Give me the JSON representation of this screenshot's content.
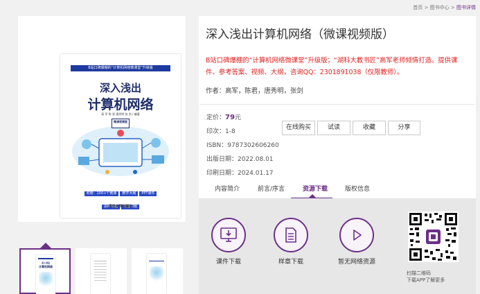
{
  "breadcrumb": {
    "home": "首页",
    "sep": " > ",
    "center": "图书中心",
    "current": "图书详情"
  },
  "cover": {
    "banner": "B站口碑爆棚的“计算机网络微课堂”升级版",
    "title_line1": "深入浅出",
    "title_line2": "计算机网络",
    "authors": "高 军  陈 君  唐秀明  张 剑 / 编著",
    "tag": "微课视频版",
    "pills": [
      "附赠：100+个微课",
      "教学大纲",
      "PPT课件",
      "思维导图",
      "配套习题"
    ],
    "publisher": "清华大学出版社"
  },
  "book": {
    "title": "深入浅出计算机网络（微课视频版）",
    "promo": "B站口碑爆棚的“计算机网络微课堂”升级版；“湖科大教书匠”高军老师倾情打造。提供课件、参考答案、视频、大纲，咨询QQ：2301891038（仅限教师）。",
    "author": "作者：高军，陈君，唐秀明，张剑",
    "price_label": "定价：",
    "price": "79",
    "price_unit": "元",
    "impression": "印次：1-8",
    "isbn": "ISBN：9787302606260",
    "pub_date": "出版日期：2022.08.01",
    "print_date": "印刷日期：2024.01.17"
  },
  "actions": {
    "buy": "在线购买",
    "read": "试读",
    "favorite": "收藏",
    "share": "分享"
  },
  "tabs": [
    "内容简介",
    "前言/序言",
    "资源下载",
    "版权信息"
  ],
  "resources": [
    {
      "label": "课件下载",
      "icon": "monitor-download-icon"
    },
    {
      "label": "样章下载",
      "icon": "document-icon"
    },
    {
      "label": "暂无网络资源",
      "icon": "play-icon"
    }
  ],
  "qr": {
    "caption1": "扫描二维码",
    "caption2": "下载APP了解更多"
  },
  "colors": {
    "accent": "#6b2f87",
    "promo": "#e02020",
    "cover_blue": "#1e3a9f"
  }
}
